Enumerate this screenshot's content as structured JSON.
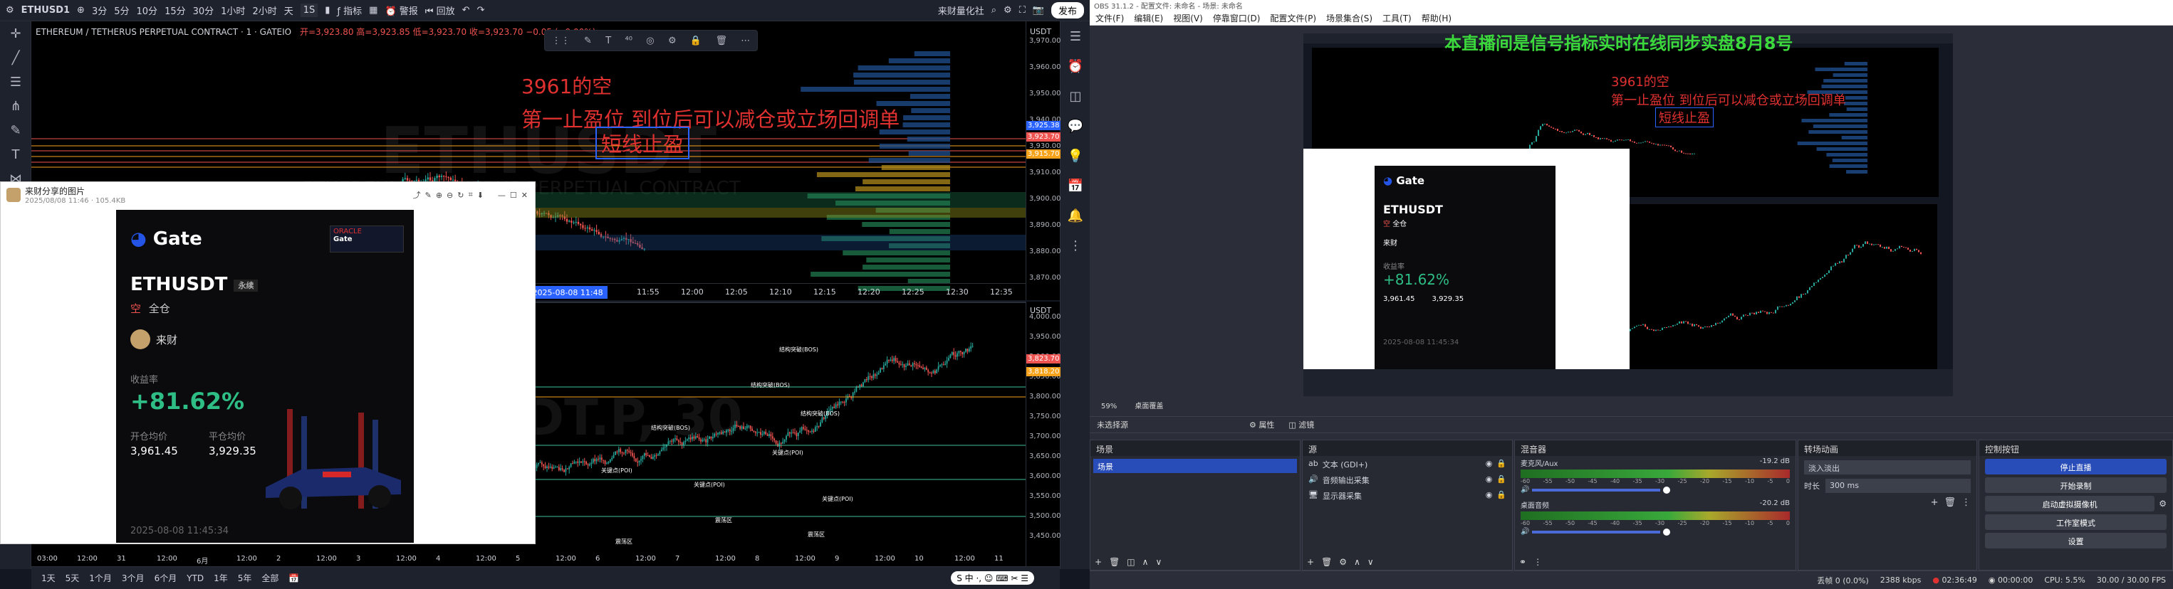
{
  "tv": {
    "symbol": "ETHUSD1",
    "intervals": [
      "3分",
      "5分",
      "10分",
      "15分",
      "30分",
      "1小时",
      "2小时",
      "天"
    ],
    "interval_active": "1S",
    "indicators_label": "指标",
    "alert_label": "警报",
    "replay_label": "回放",
    "broker_label": "来财量化社",
    "publish_label": "发布",
    "chart_title": "ETHEREUM / TETHERUS PERPETUAL CONTRACT · 1 · GATEIO",
    "ohlc": "开=3,923.80 高=3,923.85 低=3,923.70 收=3,923.70 −0.05 (−0.00%)",
    "usdt_label": "USDT",
    "price_ticks_top": [
      "3,970.00",
      "3,960.00",
      "3,950.00",
      "3,940.00",
      "3,930.00",
      "3,910.00",
      "3,900.00",
      "3,890.00",
      "3,880.00",
      "3,870.00"
    ],
    "price_ticks_bottom": [
      "4,000.00",
      "3,950.00",
      "3,900.00",
      "3,850.00",
      "3,800.00",
      "3,750.00",
      "3,700.00",
      "3,650.00",
      "3,600.00",
      "3,550.00",
      "3,500.00",
      "3,450.00"
    ],
    "price_tag_1": "3,925.38",
    "price_tag_2": "3,923.70",
    "price_tag_3": "3,915.70",
    "price_tag_4": "3,823.70",
    "price_tag_5": "3,818.20",
    "time_ticks_top": [
      "11:55",
      "12:00",
      "12:05",
      "12:10",
      "12:15",
      "12:20",
      "12:25",
      "12:30",
      "12:35"
    ],
    "time_marker": "周五 2025-08-08   11:48",
    "time_ticks_bottom": [
      "03:00",
      "12:00",
      "31",
      "12:00",
      "6月",
      "12:00",
      "2",
      "12:00",
      "3",
      "12:00",
      "4",
      "12:00",
      "5",
      "12:00",
      "6",
      "12:00",
      "7",
      "12:00",
      "8",
      "12:00",
      "9",
      "12:00",
      "10",
      "12:00",
      "11"
    ],
    "watermark_top": "ETHUSDT",
    "watermark_top_sub": "ETHEREUM / TETHERUS PERPETUAL CONTRACT",
    "watermark_bottom": "DT.P, 30",
    "annot_short": "3961的空",
    "annot_note": "第一止盈位 到位后可以减仓或立场回调单",
    "annot_box": "短线止盈",
    "chart_labels": [
      "结构突破(BOS)",
      "结构突破(BOS)",
      "结构突破(BOS)",
      "结构突破(BOS)",
      "关键点(POI)",
      "关键点(POI)",
      "关键点(POI)",
      "关键点(POI)",
      "震荡区",
      "震荡区",
      "震荡区"
    ],
    "ranges": [
      "1天",
      "5天",
      "1个月",
      "3个月",
      "6个月",
      "YTD",
      "1年",
      "5年",
      "全部"
    ]
  },
  "popup": {
    "title": "来财分享的图片",
    "meta": "2025/08/08 11:46 · 105.4KB",
    "brand": "Gate",
    "oracle_brand": "Gate",
    "oracle_text": "ORACLE",
    "pair": "ETHUSDT",
    "contract_type": "永续",
    "side": "空",
    "margin": "全仓",
    "user": "来财",
    "roi_label": "收益率",
    "roi": "+81.62%",
    "entry_label": "开仓均价",
    "entry": "3,961.45",
    "close_label": "平仓均价",
    "close": "3,929.35",
    "timestamp": "2025-08-08 11:45:34"
  },
  "obs": {
    "window_title": "OBS 31.1.2 - 配置文件: 未命名 - 场景: 未命名",
    "menu": [
      "文件(F)",
      "编辑(E)",
      "视图(V)",
      "停靠窗口(D)",
      "配置文件(P)",
      "场景集合(S)",
      "工具(T)",
      "帮助(H)"
    ],
    "banner": "本直播间是信号指标实时在线同步实盘8月8号",
    "preview_short": "3961的空",
    "preview_note": "第一止盈位 到位后可以减仓或立场回调单",
    "preview_box": "短线止盈",
    "zoom": "59%",
    "preview_source": "桌面覆盖",
    "no_source": "未选择源",
    "props_label": "属性",
    "filters_label": "滤镜",
    "scenes_title": "场景",
    "scene_item": "场景",
    "sources_title": "源",
    "sources": [
      "文本 (GDI+)",
      "音频输出采集",
      "显示器采集"
    ],
    "mixer_title": "混音器",
    "mixer_items": [
      {
        "name": "麦克风/Aux",
        "db": "-19.2 dB"
      },
      {
        "name": "桌面音频",
        "db": "-20.2 dB"
      }
    ],
    "meter_ticks": [
      "-60",
      "-55",
      "-50",
      "-45",
      "-40",
      "-35",
      "-30",
      "-25",
      "-20",
      "-15",
      "-10",
      "-5",
      "0"
    ],
    "transition_title": "转场动画",
    "transition_value": "淡入淡出",
    "duration_label": "时长",
    "duration_value": "300 ms",
    "controls_title": "控制按钮",
    "controls": [
      "停止直播",
      "开始录制",
      "启动虚拟摄像机",
      "工作室模式",
      "设置"
    ],
    "status": {
      "dropped": "丢帧 0 (0.0%)",
      "bitrate": "2388 kbps",
      "live": "02:36:49",
      "rec": "00:00:00",
      "cpu": "CPU: 5.5%",
      "fps": "30.00 / 30.00 FPS"
    }
  },
  "colors": {
    "tv_bg": "#131722",
    "up": "#26a69a",
    "down": "#ef5350",
    "annot_red": "#e03131",
    "obs_bg": "#2b2e38",
    "obs_accent": "#284cb8",
    "banner_green": "#3cd93c",
    "roi_green": "#2ebd85"
  }
}
